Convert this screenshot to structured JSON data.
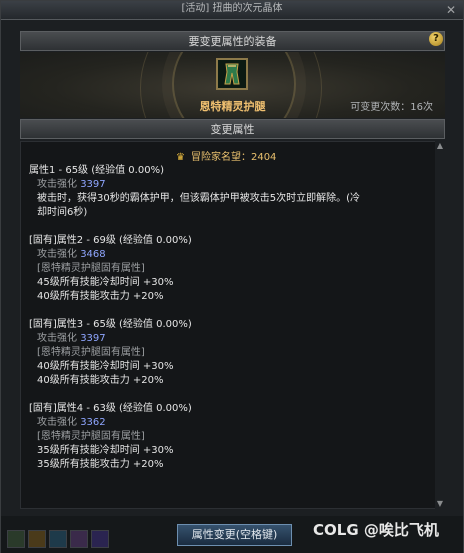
{
  "window": {
    "title": "[活动] 扭曲的次元晶体",
    "close_label": "✕"
  },
  "equip_section": {
    "header": "要变更属性的装备",
    "item_name": "恩特精灵护腿",
    "remaining_changes": "可变更次数：16次",
    "help_label": "?"
  },
  "change_section": {
    "header": "变更属性",
    "fame": "冒险家名望：2404"
  },
  "attributes": [
    {
      "title": "属性1 - 65级 (经验值 0.00%)",
      "enhance_label": "攻击强化",
      "enhance_value": "3397",
      "desc1": "被击时，获得30秒的霸体护甲，但该霸体护甲被攻击5次时立即解除。(冷",
      "desc2": "却时间6秒)"
    },
    {
      "title": "[固有]属性2 - 69级 (经验值 0.00%)",
      "enhance_label": "攻击强化",
      "enhance_value": "3468",
      "inherent": "[恩特精灵护腿固有属性]",
      "line1": "45级所有技能冷却时间 +30%",
      "line2": "40级所有技能攻击力 +20%"
    },
    {
      "title": "[固有]属性3 - 65级 (经验值 0.00%)",
      "enhance_label": "攻击强化",
      "enhance_value": "3397",
      "inherent": "[恩特精灵护腿固有属性]",
      "line1": "40级所有技能冷却时间 +30%",
      "line2": "40级所有技能攻击力 +20%"
    },
    {
      "title": "[固有]属性4 - 63级 (经验值 0.00%)",
      "enhance_label": "攻击强化",
      "enhance_value": "3362",
      "inherent": "[恩特精灵护腿固有属性]",
      "line1": "35级所有技能冷却时间 +30%",
      "line2": "35级所有技能攻击力 +20%"
    }
  ],
  "footer": {
    "confirm_button": "属性变更(空格键)",
    "watermark": "COLG @唉比飞机"
  },
  "icons": {
    "fame": "crown-icon",
    "item": "leg-armor-icon",
    "help": "question-icon"
  },
  "colors": {
    "item_name": "#f0c070",
    "fame": "#e9c06e",
    "enhance_value": "#8fa6ff",
    "button": "#36526e"
  }
}
